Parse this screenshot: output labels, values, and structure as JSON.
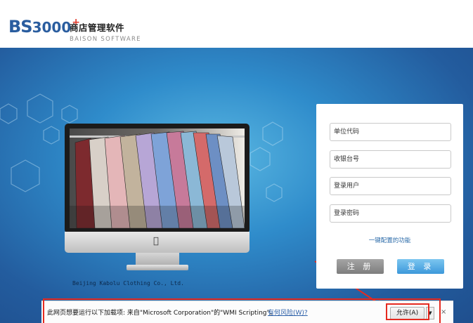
{
  "header": {
    "logo_bs": "BS",
    "logo_num": "3000",
    "logo_plus": "+",
    "title_cn": "商店管理软件",
    "title_en": "BAISON SOFTWARE"
  },
  "monitor": {
    "company": "Beijing Kabolu Clothing Co., Ltd."
  },
  "login": {
    "unit_code": "单位代码",
    "register_no": "收银台号",
    "user": "登录用户",
    "password": "登录密码",
    "quick_config": "一键配置的功能",
    "register_btn": "注 册",
    "login_btn": "登 录",
    "login_color": "#3c98da"
  },
  "infobar": {
    "message": "此网页想要运行以下加载项: 来自\"Microsoft Corporation\"的\"WMI Scripting\"。",
    "risk_link": "有何风险(W)?",
    "allow": "允许(A)",
    "dropdown": "▼",
    "close": "×",
    "annotation_color": "#e52a20"
  }
}
